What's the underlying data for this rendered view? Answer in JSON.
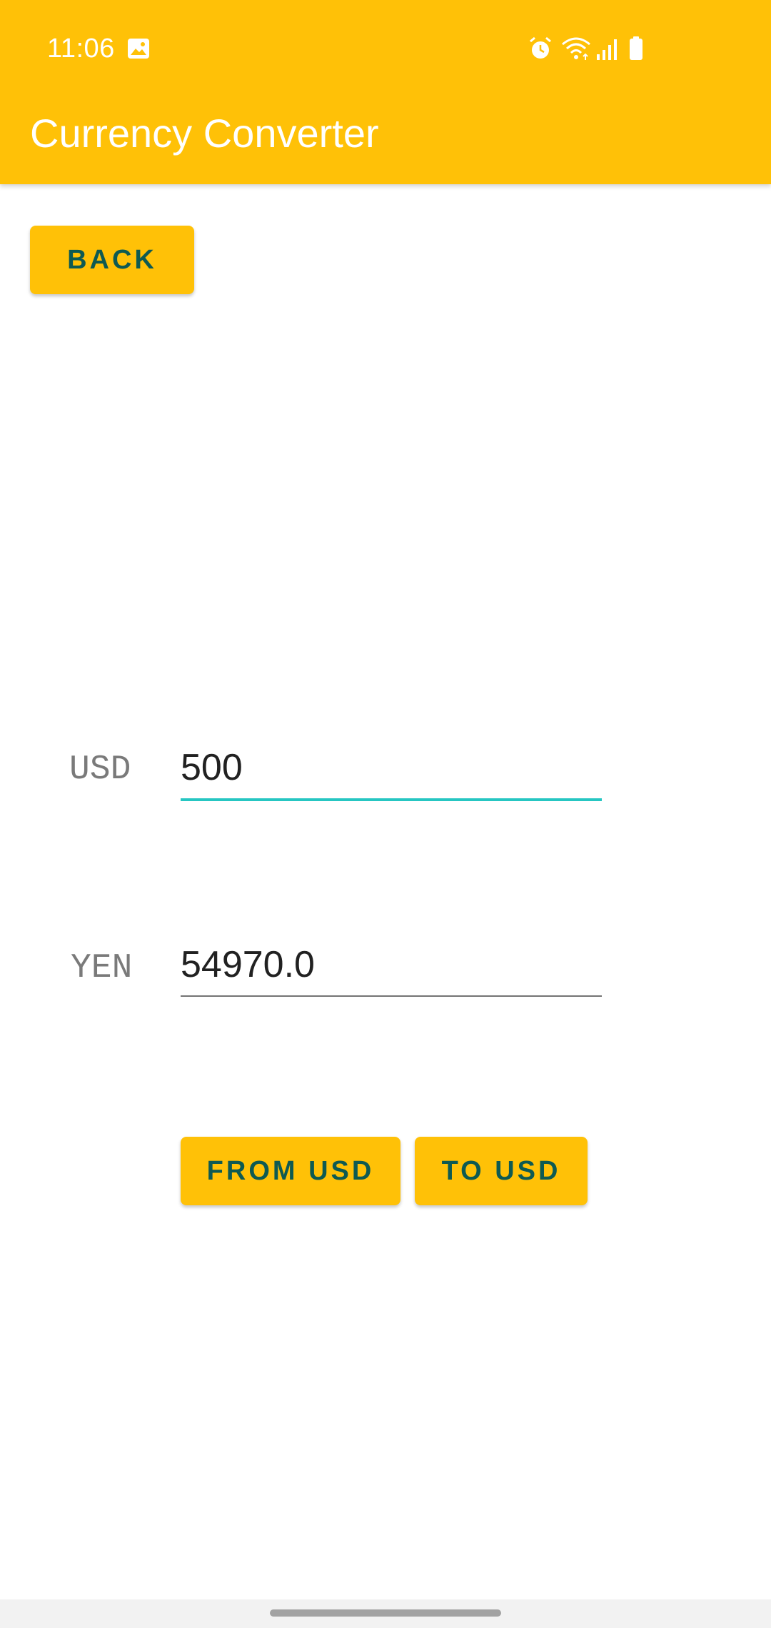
{
  "status_bar": {
    "time": "11:06",
    "icons": [
      "gallery-icon",
      "alarm-icon",
      "wifi-icon",
      "signal-icon",
      "battery-icon"
    ]
  },
  "app_bar": {
    "title": "Currency Converter",
    "color": "#FFC107"
  },
  "back_button": {
    "label": "BACK"
  },
  "converter": {
    "usd": {
      "label": "USD",
      "value": "500"
    },
    "yen": {
      "label": "YEN",
      "value": "54970.0"
    }
  },
  "actions": {
    "from_usd_label": "FROM USD",
    "to_usd_label": "TO USD"
  },
  "colors": {
    "accent": "#FFC107",
    "button_text": "#0E5A52",
    "focused_underline": "#26C6C2"
  }
}
